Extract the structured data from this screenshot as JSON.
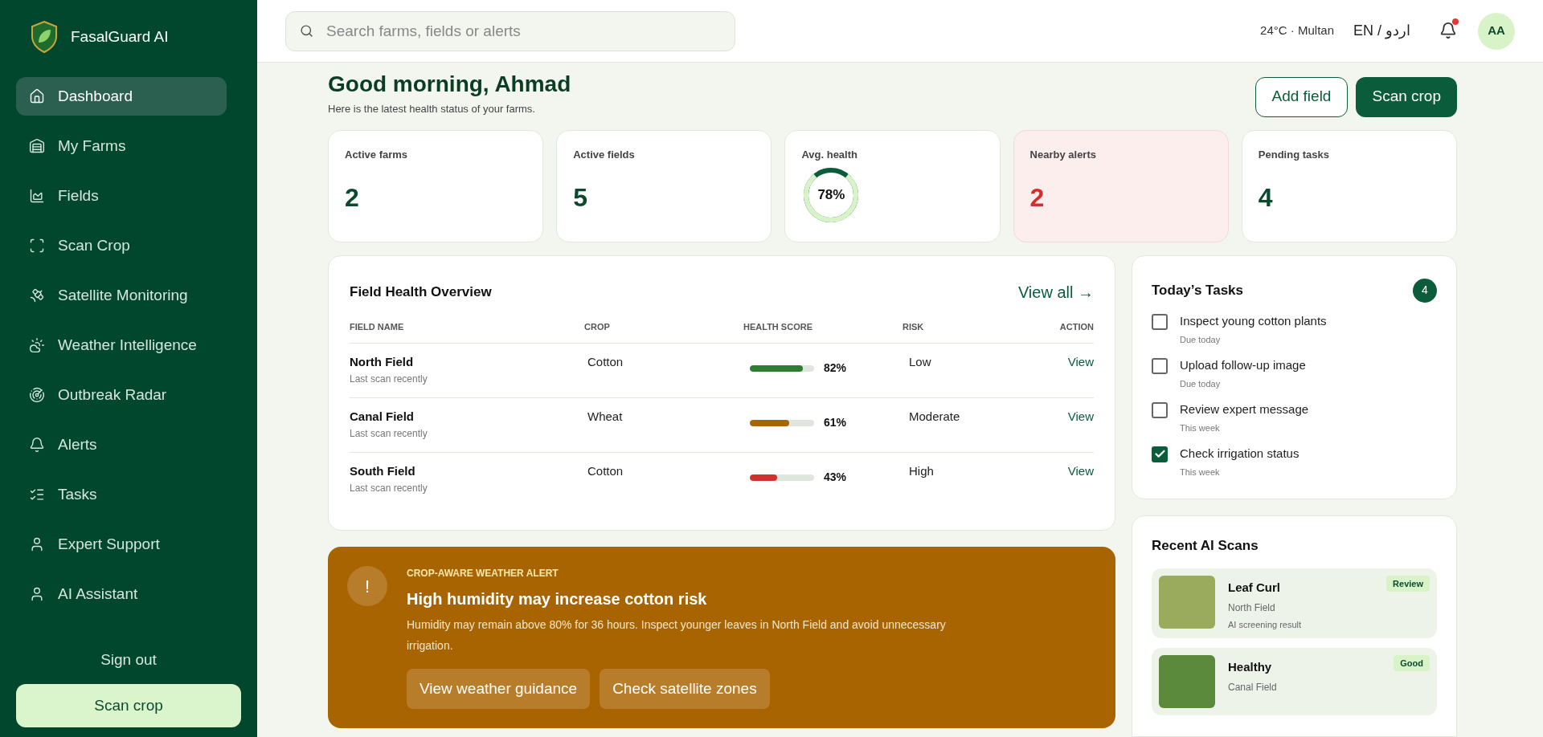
{
  "sidebar": {
    "brand": "FasalGuard AI",
    "items": [
      {
        "label": "Dashboard",
        "selected": true
      },
      {
        "label": "My Farms",
        "selected": false
      },
      {
        "label": "Fields",
        "selected": false
      },
      {
        "label": "Scan Crop",
        "selected": false
      },
      {
        "label": "Satellite Monitoring",
        "selected": false
      },
      {
        "label": "Weather Intelligence",
        "selected": false
      },
      {
        "label": "Outbreak Radar",
        "selected": false
      },
      {
        "label": "Alerts",
        "selected": false
      },
      {
        "label": "Tasks",
        "selected": false
      },
      {
        "label": "Expert Support",
        "selected": false
      },
      {
        "label": "AI Assistant",
        "selected": false
      }
    ],
    "sign_out": "Sign out",
    "scan_button": "Scan crop"
  },
  "header": {
    "search": {
      "placeholder": "Search farms, fields or alerts"
    },
    "weather": "24°C · Multan",
    "language": "EN / اردو",
    "notifications_unread": true,
    "avatar": "AA"
  },
  "greeting": {
    "title": "Good morning, Ahmad",
    "subtitle": "Here is the latest health status of your farms.",
    "buttons": [
      {
        "label": "Add field",
        "kind": "outline"
      },
      {
        "label": "Scan crop",
        "kind": "solid"
      }
    ]
  },
  "stats": [
    {
      "label": "Active farms",
      "value": "2",
      "kind": "number",
      "alert": false
    },
    {
      "label": "Active fields",
      "value": "5",
      "kind": "number",
      "alert": false
    },
    {
      "label": "Avg. health",
      "value": "78%",
      "kind": "ring",
      "level": 0.78,
      "alert": false
    },
    {
      "label": "Nearby alerts",
      "value": "2",
      "kind": "number",
      "alert": true
    },
    {
      "label": "Pending tasks",
      "value": "4",
      "kind": "number",
      "alert": false
    }
  ],
  "field_health": {
    "title": "Field Health Overview",
    "link": "View all →",
    "columns": [
      "FIELD NAME",
      "CROP",
      "HEALTH SCORE",
      "RISK",
      "ACTION"
    ],
    "rows": [
      {
        "name": "North Field",
        "sub": "Last scan recently",
        "crop": "Cotton",
        "level": 0.82,
        "color": "#2e7d32",
        "score": "82%",
        "risk": "Low",
        "action": "View"
      },
      {
        "name": "Canal Field",
        "sub": "Last scan recently",
        "crop": "Wheat",
        "level": 0.61,
        "color": "#a86400",
        "score": "61%",
        "risk": "Moderate",
        "action": "View"
      },
      {
        "name": "South Field",
        "sub": "Last scan recently",
        "crop": "Cotton",
        "level": 0.43,
        "color": "#d32f2f",
        "score": "43%",
        "risk": "High",
        "action": "View"
      }
    ]
  },
  "weather_alert": {
    "icon": "!",
    "eyebrow": "CROP-AWARE WEATHER ALERT",
    "title": "High humidity may increase cotton risk",
    "body": "Humidity may remain above 80% for 36 hours. Inspect younger leaves in North Field and avoid unnecessary irrigation.",
    "buttons": [
      "View weather guidance",
      "Check satellite zones"
    ]
  },
  "tasks": {
    "title": "Today’s Tasks",
    "count": "4",
    "items": [
      {
        "label": "Inspect young cotton plants",
        "due": "Due today",
        "checked": false
      },
      {
        "label": "Upload follow-up image",
        "due": "Due today",
        "checked": false
      },
      {
        "label": "Review expert message",
        "due": "This week",
        "checked": false
      },
      {
        "label": "Check irrigation status",
        "due": "This week",
        "checked": true
      }
    ]
  },
  "recent_scans": {
    "title": "Recent AI Scans",
    "items": [
      {
        "name": "Leaf Curl",
        "field": "North Field",
        "note": "AI screening result",
        "badge": "Review"
      },
      {
        "name": "Healthy",
        "field": "Canal Field",
        "badge": "Good"
      }
    ]
  }
}
